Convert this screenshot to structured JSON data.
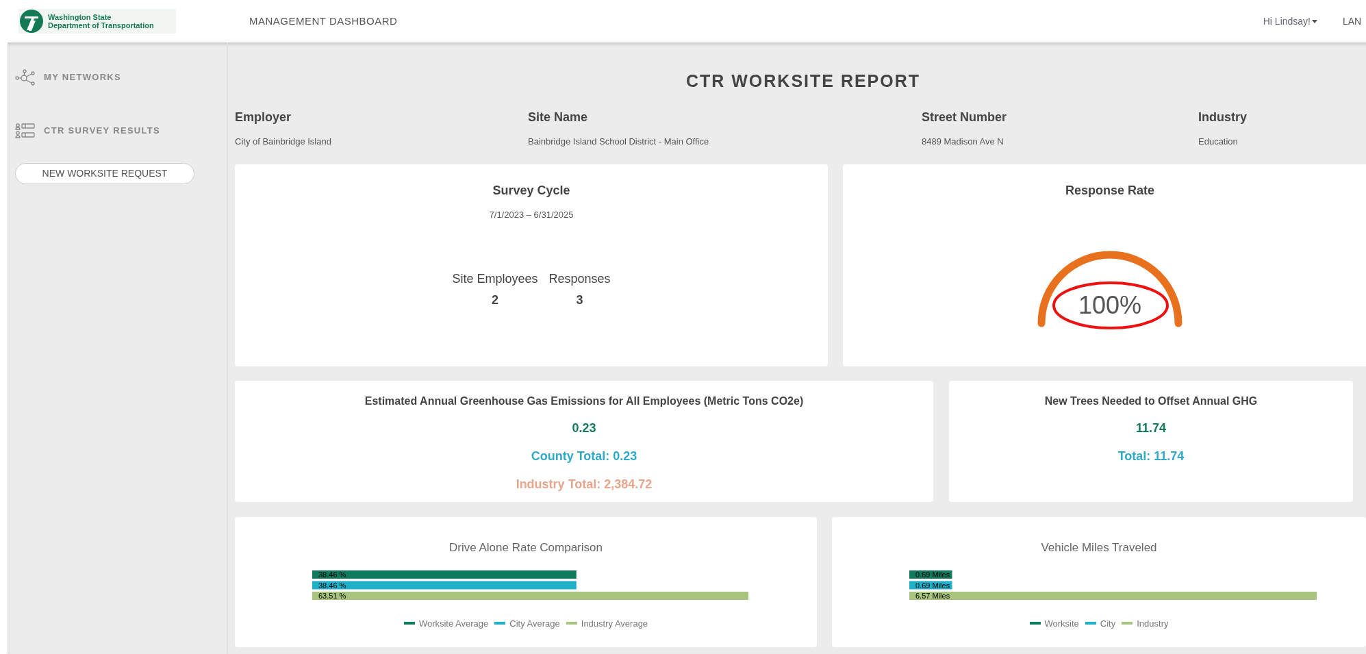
{
  "header": {
    "logo_lines": [
      "Washington State",
      "Department of Transportation"
    ],
    "title": "MANAGEMENT DASHBOARD",
    "user_menu": "Hi Lindsay!",
    "language": "LAN"
  },
  "sidebar": {
    "items": [
      {
        "kind": "network",
        "label": "MY NETWORKS"
      },
      {
        "kind": "survey",
        "label": "CTR SURVEY RESULTS"
      }
    ],
    "button": "NEW WORKSITE REQUEST"
  },
  "report": {
    "title": "CTR WORKSITE REPORT",
    "fields": [
      {
        "label": "Employer",
        "value": "City of Bainbridge Island"
      },
      {
        "label": "Site Name",
        "value": "Bainbridge Island School District - Main Office"
      },
      {
        "label": "Street Number",
        "value": "8489 Madison Ave N"
      },
      {
        "label": "Industry",
        "value": "Education"
      }
    ]
  },
  "survey_cycle": {
    "title": "Survey Cycle",
    "dates": "7/1/2023 – 6/31/2025",
    "stats": [
      {
        "label": "Site Employees",
        "value": "2"
      },
      {
        "label": "Responses",
        "value": "3"
      }
    ]
  },
  "response_rate": {
    "title": "Response Rate",
    "value": "100%",
    "highlighted": true
  },
  "emissions": {
    "title": "Estimated Annual Greenhouse Gas Emissions for All Employees (Metric Tons CO2e)",
    "lines": [
      {
        "text": "0.23",
        "color": "#127a5f"
      },
      {
        "text": "County Total: 0.23",
        "color": "#2eaac8"
      },
      {
        "text": "Industry Total: 2,384.72",
        "color": "#e8a68c"
      }
    ]
  },
  "trees": {
    "title": "New Trees Needed to Offset Annual GHG",
    "lines": [
      {
        "text": "11.74",
        "color": "#127a5f"
      },
      {
        "text": "Total: 11.74",
        "color": "#2eaac8"
      }
    ]
  },
  "charts": [
    {
      "chart_data": {
        "type": "bar",
        "orientation": "horizontal",
        "title": "Drive Alone Rate Comparison",
        "series": [
          {
            "name": "Worksite Average",
            "color": "#0e7a5e",
            "values": [
              38.46
            ],
            "value_labels": [
              "38.46 %"
            ]
          },
          {
            "name": "City Average",
            "color": "#1eb0c9",
            "values": [
              38.46
            ],
            "value_labels": [
              "38.46 %"
            ]
          },
          {
            "name": "Industry Average",
            "color": "#a8c47f",
            "values": [
              63.51
            ],
            "value_labels": [
              "63.51 %"
            ]
          }
        ],
        "data_labels": true
      }
    },
    {
      "chart_data": {
        "type": "bar",
        "orientation": "horizontal",
        "title": "Vehicle Miles Traveled",
        "series": [
          {
            "name": "Worksite",
            "color": "#0e7a5e",
            "values": [
              0.69
            ],
            "value_labels": [
              "0.69 Miles"
            ]
          },
          {
            "name": "City",
            "color": "#1eb0c9",
            "values": [
              0.69
            ],
            "value_labels": [
              "0.69 Miles"
            ]
          },
          {
            "name": "Industry",
            "color": "#a8c47f",
            "values": [
              6.57
            ],
            "value_labels": [
              "6.57 Miles"
            ]
          }
        ],
        "data_labels": true
      }
    }
  ]
}
